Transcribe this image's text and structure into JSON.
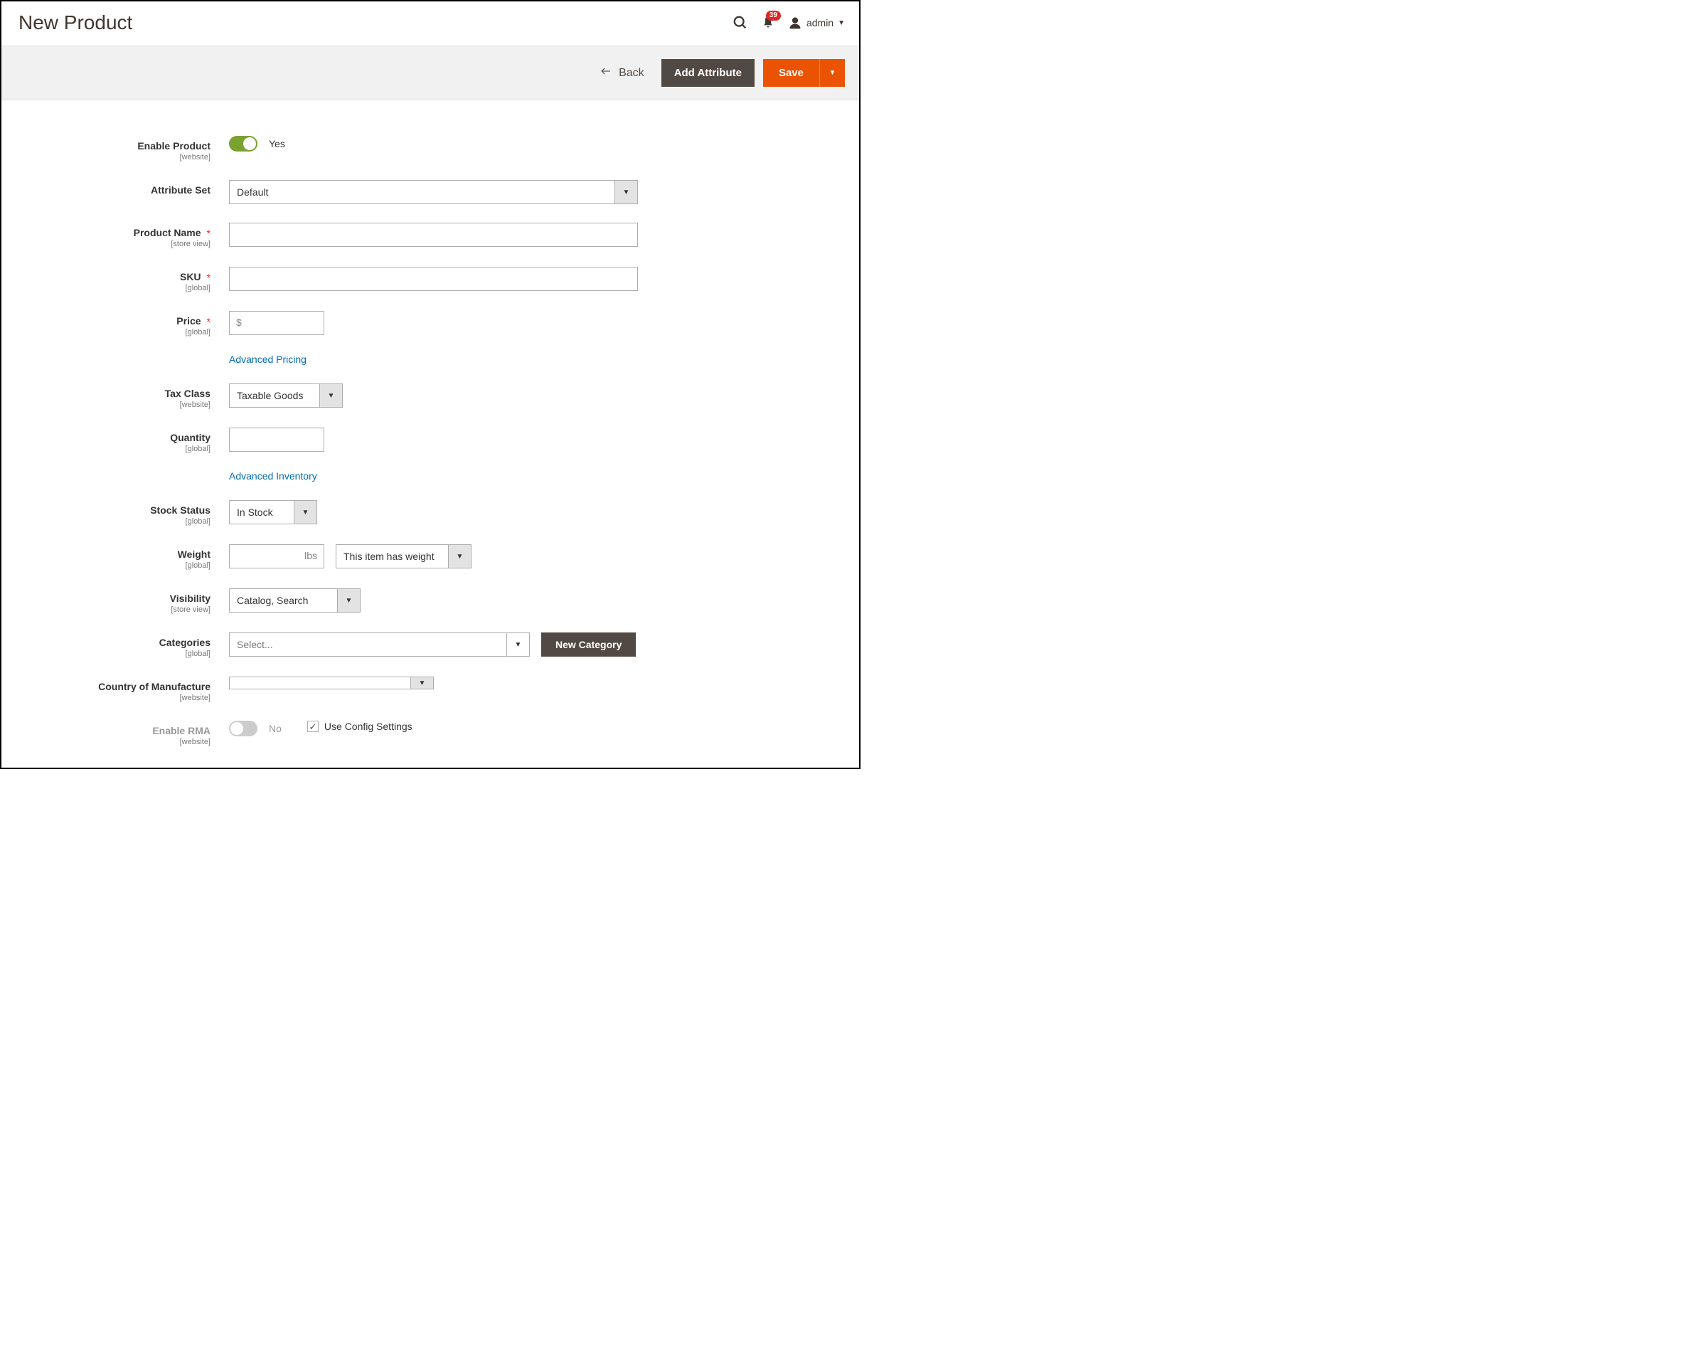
{
  "header": {
    "title": "New Product",
    "notification_count": "39",
    "user_name": "admin"
  },
  "toolbar": {
    "back_label": "Back",
    "add_attribute_label": "Add Attribute",
    "save_label": "Save"
  },
  "form": {
    "enable_product": {
      "label": "Enable Product",
      "scope": "[website]",
      "value_label": "Yes"
    },
    "attribute_set": {
      "label": "Attribute Set",
      "value": "Default"
    },
    "product_name": {
      "label": "Product Name",
      "scope": "[store view]",
      "value": ""
    },
    "sku": {
      "label": "SKU",
      "scope": "[global]",
      "value": ""
    },
    "price": {
      "label": "Price",
      "scope": "[global]",
      "currency": "$",
      "value": "",
      "advanced_link": "Advanced Pricing"
    },
    "tax_class": {
      "label": "Tax Class",
      "scope": "[website]",
      "value": "Taxable Goods"
    },
    "quantity": {
      "label": "Quantity",
      "scope": "[global]",
      "value": "",
      "advanced_link": "Advanced Inventory"
    },
    "stock_status": {
      "label": "Stock Status",
      "scope": "[global]",
      "value": "In Stock"
    },
    "weight": {
      "label": "Weight",
      "scope": "[global]",
      "unit": "lbs",
      "value": "",
      "has_weight_value": "This item has weight"
    },
    "visibility": {
      "label": "Visibility",
      "scope": "[store view]",
      "value": "Catalog, Search"
    },
    "categories": {
      "label": "Categories",
      "scope": "[global]",
      "placeholder": "Select...",
      "new_category_label": "New Category"
    },
    "country": {
      "label": "Country of Manufacture",
      "scope": "[website]",
      "value": ""
    },
    "enable_rma": {
      "label": "Enable RMA",
      "scope": "[website]",
      "value_label": "No",
      "use_config_label": "Use Config Settings"
    }
  }
}
